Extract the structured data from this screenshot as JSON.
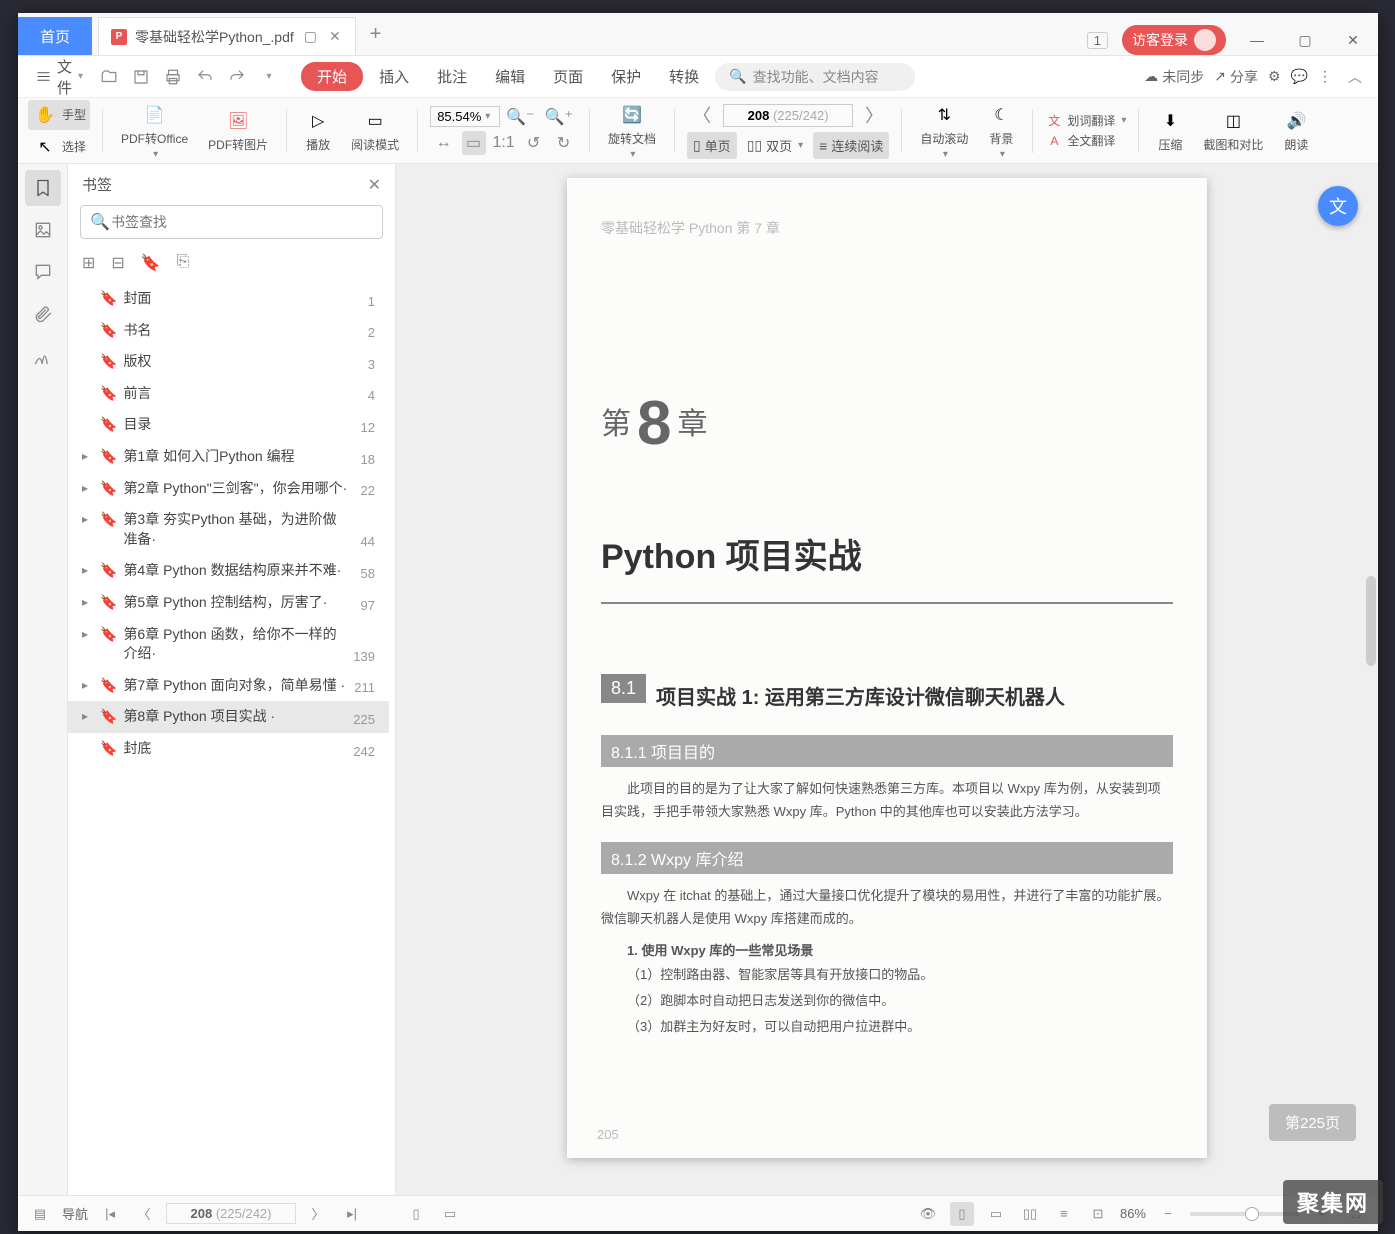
{
  "title": {
    "home": "首页",
    "filename": "零基础轻松学Python_.pdf",
    "badge": "1",
    "login": "访客登录"
  },
  "menubar": {
    "file": "文件",
    "items": [
      "开始",
      "插入",
      "批注",
      "编辑",
      "页面",
      "保护",
      "转换"
    ],
    "search_ph": "查找功能、文档内容",
    "unsync": "未同步",
    "share": "分享"
  },
  "ribbon": {
    "hand": "手型",
    "select": "选择",
    "to_office": "PDF转Office",
    "to_image": "PDF转图片",
    "play": "播放",
    "read_mode": "阅读模式",
    "zoom": "85.54%",
    "rotate": "旋转文档",
    "page_cur": "208",
    "page_tot": "(225/242)",
    "single": "单页",
    "double": "双页",
    "cont": "连续阅读",
    "auto_scroll": "自动滚动",
    "bg": "背景",
    "word_trans": "划词翻译",
    "full_trans": "全文翻译",
    "compress": "压缩",
    "compare": "截图和对比",
    "tts": "朗读"
  },
  "sidebar": {
    "title": "书签",
    "search_ph": "书签查找",
    "items": [
      {
        "expand": "",
        "label": "封面",
        "page": "1"
      },
      {
        "expand": "",
        "label": "书名",
        "page": "2"
      },
      {
        "expand": "",
        "label": "版权",
        "page": "3"
      },
      {
        "expand": "",
        "label": "前言",
        "page": "4"
      },
      {
        "expand": "",
        "label": "目录",
        "page": "12"
      },
      {
        "expand": "▸",
        "label": "第1章 如何入门Python 编程",
        "page": "18"
      },
      {
        "expand": "▸",
        "label": "第2章 Python\"三剑客\"，你会用哪个·",
        "page": "22"
      },
      {
        "expand": "▸",
        "label": "第3章 夯实Python 基础，为进阶做准备·",
        "page": "44"
      },
      {
        "expand": "▸",
        "label": "第4章 Python 数据结构原来并不难·",
        "page": "58"
      },
      {
        "expand": "▸",
        "label": "第5章 Python 控制结构，厉害了·",
        "page": "97"
      },
      {
        "expand": "▸",
        "label": "第6章 Python 函数，给你不一样的介绍·",
        "page": "139"
      },
      {
        "expand": "▸",
        "label": "第7章 Python 面向对象，简单易懂 ·",
        "page": "211"
      },
      {
        "expand": "▸",
        "label": "第8章 Python 项目实战 ·",
        "page": "225",
        "sel": true
      },
      {
        "expand": "",
        "label": "封底",
        "page": "242"
      }
    ]
  },
  "page": {
    "ghost": "零基础轻松学 Python  第 7 章",
    "ch_pre": "第",
    "ch_num": "8",
    "ch_suf": "章",
    "ch_sub": "Python 项目实战",
    "sec_num": "8.1",
    "sec_title": "项目实战 1: 运用第三方库设计微信聊天机器人",
    "sub1": "8.1.1   项目目的",
    "p1": "此项目的目的是为了让大家了解如何快速熟悉第三方库。本项目以 Wxpy 库为例，从安装到项目实践，手把手带领大家熟悉 Wxpy 库。Python 中的其他库也可以安装此方法学习。",
    "sub2": "8.1.2   Wxpy 库介绍",
    "p2": "Wxpy 在 itchat 的基础上，通过大量接口优化提升了模块的易用性，并进行了丰富的功能扩展。微信聊天机器人是使用 Wxpy 库搭建而成的。",
    "use_head": "1.  使用 Wxpy 库的一些常见场景",
    "li1": "（1）控制路由器、智能家居等具有开放接口的物品。",
    "li2": "（2）跑脚本时自动把日志发送到你的微信中。",
    "li3": "（3）加群主为好友时，可以自动把用户拉进群中。",
    "btm": "205",
    "pill": "第225页"
  },
  "status": {
    "nav": "导航",
    "page_cur": "208",
    "page_tot": "(225/242)",
    "zoom": "86%"
  },
  "watermark": "聚集网"
}
